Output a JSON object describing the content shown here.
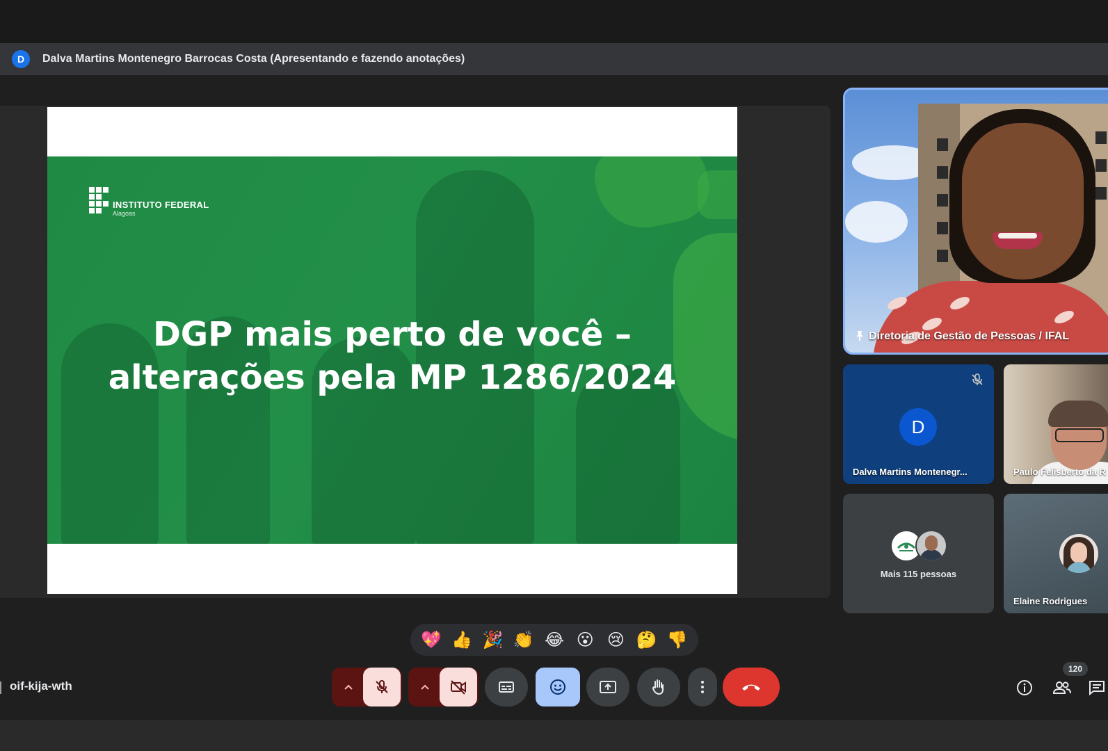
{
  "presenter_bar": {
    "avatar_letter": "D",
    "text": "Dalva Martins Montenegro Barrocas Costa (Apresentando e fazendo anotações)"
  },
  "slide": {
    "logo_title": "INSTITUTO FEDERAL",
    "logo_subtitle": "Alagoas",
    "title_line1": "DGP mais perto de você –",
    "title_line2": "alterações pela MP 1286/2024",
    "accent_color": "#228f48"
  },
  "participants": {
    "main_tile_label": "Diretoria de Gestão de Pessoas / IFAL",
    "dalva_tile": {
      "avatar_letter": "D",
      "label": "Dalva Martins Montenegr..."
    },
    "paulo_tile": {
      "label": "Paulo Felisberto da R"
    },
    "more_tile": {
      "label": "Mais 115 pessoas"
    },
    "elaine_tile": {
      "label": "Elaine Rodrigues"
    }
  },
  "reactions": [
    "💖",
    "👍",
    "🎉",
    "👏",
    "😂",
    "😮",
    "😢",
    "🤔",
    "👎"
  ],
  "controls": {
    "meeting_code": "oif-kija-wth",
    "participant_count": "120",
    "end_call_color": "#dc362e",
    "active_button_color": "#a8c7fa"
  },
  "icons": {
    "mic": "mic-off-icon",
    "camera": "camera-off-icon",
    "captions": "captions-icon",
    "emoji": "emoji-icon",
    "present": "present-screen-icon",
    "hand": "raise-hand-icon",
    "more": "more-options-icon",
    "end": "end-call-icon",
    "info": "info-icon",
    "people": "people-icon",
    "chat": "chat-icon"
  }
}
